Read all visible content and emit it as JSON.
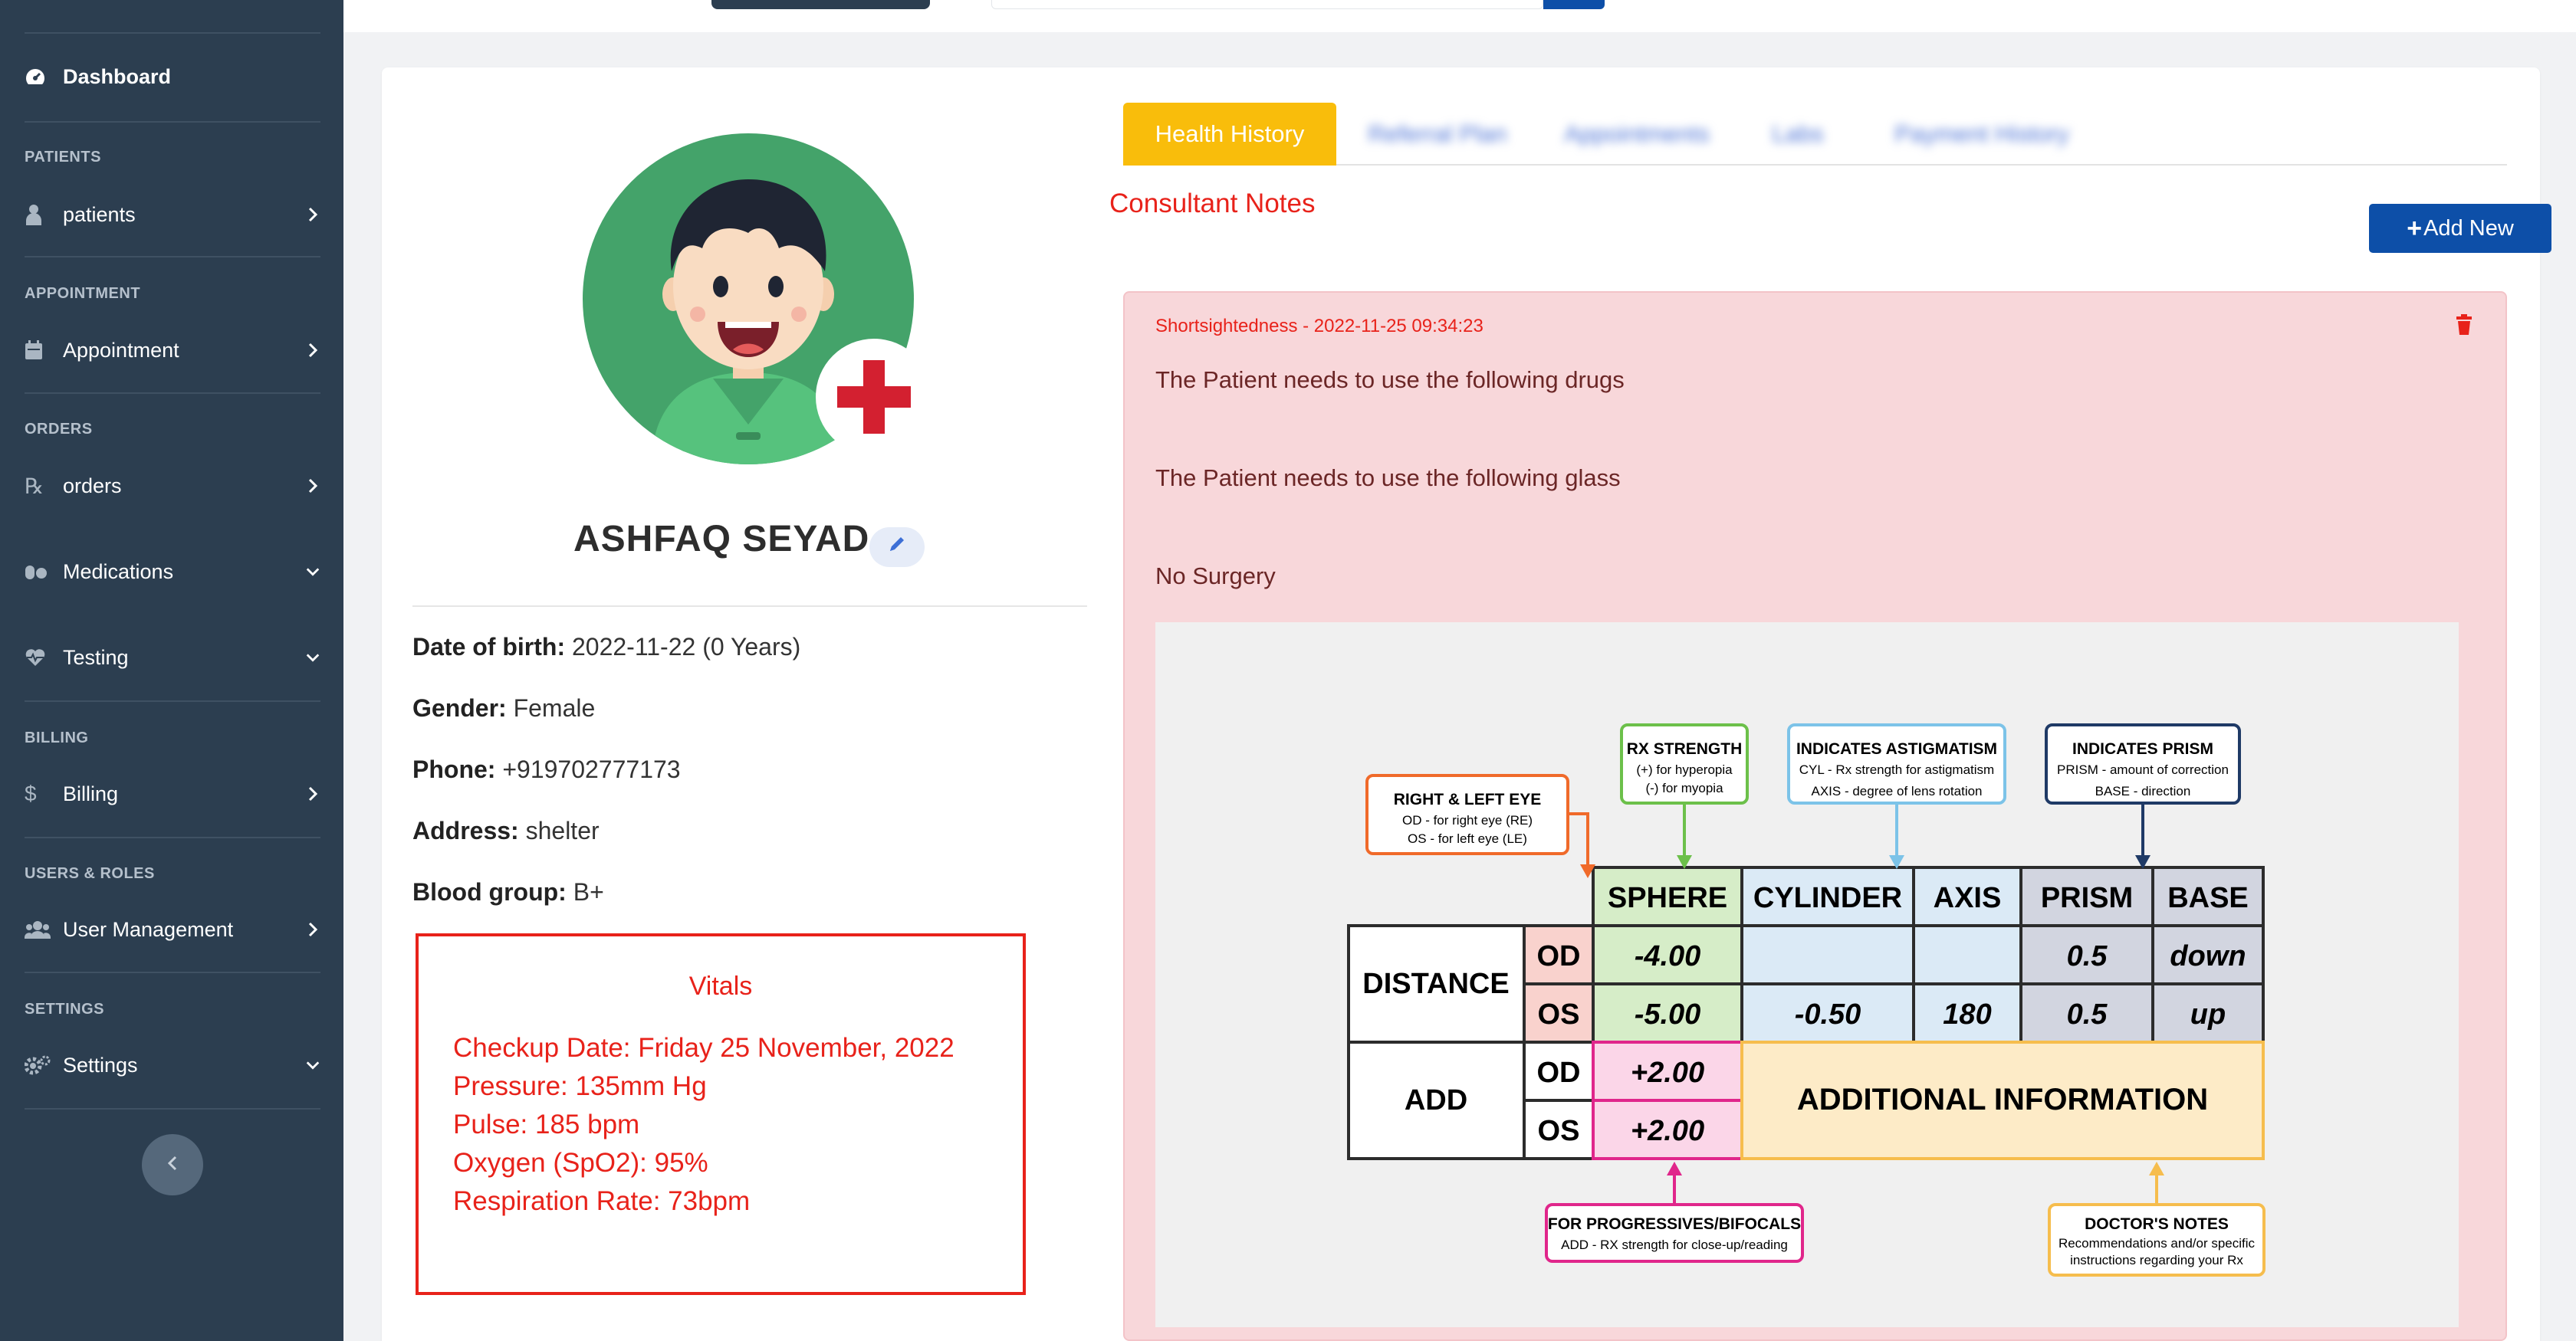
{
  "sidebar": {
    "dashboard": "Dashboard",
    "sections": [
      {
        "title": "PATIENTS",
        "item": "patients"
      },
      {
        "title": "APPOINTMENT",
        "item": "Appointment"
      },
      {
        "title": "ORDERS",
        "item": "orders"
      },
      {
        "title": "",
        "item": "Medications"
      },
      {
        "title": "",
        "item": "Testing"
      },
      {
        "title": "BILLING",
        "item": "Billing"
      },
      {
        "title": "USERS & ROLES",
        "item": "User Management"
      },
      {
        "title": "SETTINGS",
        "item": "Settings"
      }
    ]
  },
  "patient": {
    "name": "ASHFAQ SEYAD",
    "dob_label": "Date of birth:",
    "dob": " 2022-11-22 (0 Years)",
    "gender_label": "Gender:",
    "gender": " Female",
    "phone_label": "Phone:",
    "phone": " +919702777173",
    "address_label": "Address:",
    "address": " shelter",
    "blood_label": "Blood group:",
    "blood": " B+"
  },
  "vitals": {
    "title": "Vitals",
    "lines": [
      "Checkup Date: Friday 25 November, 2022",
      "Pressure: 135mm Hg",
      "Pulse: 185 bpm",
      "Oxygen (SpO2): 95%",
      "Respiration Rate: 73bpm"
    ]
  },
  "tabs": {
    "active": "Health History",
    "others": [
      "Referral Plan",
      "Appointments",
      "Labs",
      "Payment History"
    ]
  },
  "notes": {
    "heading": "Consultant Notes",
    "add_new": "Add New",
    "meta": "Shortsightedness - 2022-11-25 09:34:23",
    "drugs": "The Patient needs to use the following drugs",
    "glass": "The Patient needs to use the following glass",
    "surgery": "No Surgery"
  },
  "rx": {
    "callouts": {
      "rle_title": "RIGHT & LEFT EYE",
      "rle_l1": "OD - for right eye (RE)",
      "rle_l2": "OS - for left eye (LE)",
      "rx_title": "RX STRENGTH",
      "rx_l1": "(+)  for hyperopia",
      "rx_l2": "(-)  for myopia",
      "ast_title": "INDICATES ASTIGMATISM",
      "ast_l1": "CYL - Rx strength for astigmatism",
      "ast_l2": "AXIS - degree of lens rotation",
      "prism_title": "INDICATES PRISM",
      "prism_l1": "PRISM -  amount of correction",
      "prism_l2": "BASE - direction",
      "prog_title": "FOR PROGRESSIVES/BIFOCALS",
      "prog_l1": "ADD - RX strength for close-up/reading",
      "doc_title": "DOCTOR'S NOTES",
      "doc_l1": "Recommendations and/or specific",
      "doc_l2": "instructions regarding your Rx"
    },
    "headers": {
      "sphere": "SPHERE",
      "cylinder": "CYLINDER",
      "axis": "AXIS",
      "prism": "PRISM",
      "base": "BASE"
    },
    "distance": "DISTANCE",
    "add": "ADD",
    "od": "OD",
    "os": "OS",
    "dist_od": {
      "sphere": "-4.00",
      "cylinder": "",
      "axis": "",
      "prism": "0.5",
      "base": "down"
    },
    "dist_os": {
      "sphere": "-5.00",
      "cylinder": "-0.50",
      "axis": "180",
      "prism": "0.5",
      "base": "up"
    },
    "add_od": "+2.00",
    "add_os": "+2.00",
    "additional_info": "ADDITIONAL INFORMATION"
  },
  "colors": {
    "sidebar": "#2c3e50",
    "accent_tab": "#f9bd0b",
    "primary": "#0d4fa8",
    "danger": "#e8221a",
    "note_bg": "#f8d7da"
  }
}
